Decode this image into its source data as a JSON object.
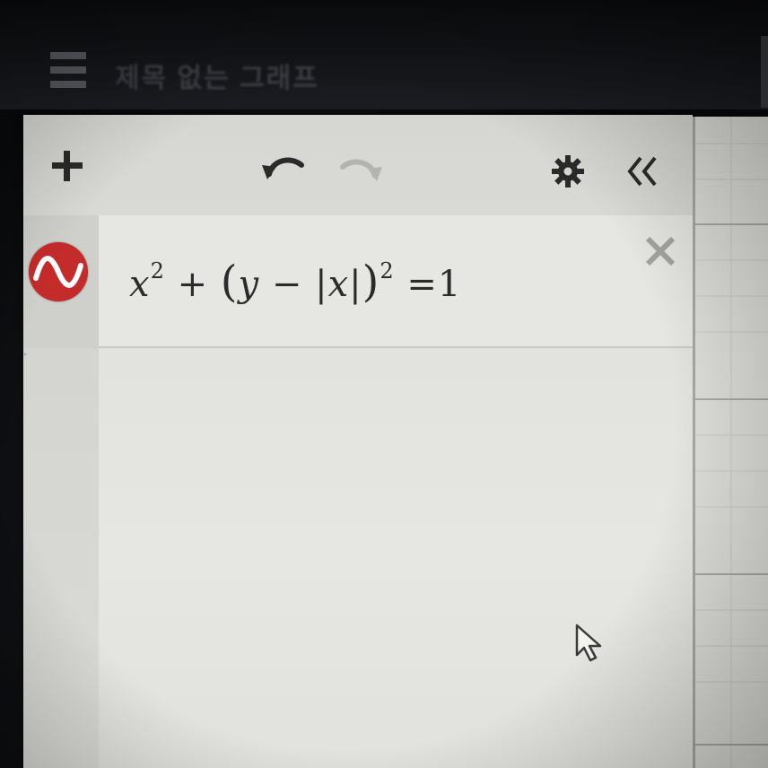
{
  "app": {
    "title": "제목 없는 그래프"
  },
  "toolbar": {
    "add_icon": "plus-icon",
    "undo_icon": "undo-icon",
    "redo_icon": "redo-icon",
    "settings_icon": "gear-icon",
    "collapse_icon": "double-chevron-left-icon"
  },
  "expressions": [
    {
      "color": "#c42b2b",
      "lhs_var1": "x",
      "lhs_exp1": "2",
      "op_plus": "+",
      "open_paren": "(",
      "var_y": "y",
      "op_minus": "−",
      "abs_open": "|",
      "abs_var": "x",
      "abs_close": "|",
      "close_paren": ")",
      "exp2": "2",
      "equals": "=",
      "rhs": "1"
    }
  ],
  "colors": {
    "expression_red": "#c42b2b",
    "panel_bg": "#e4e4e0",
    "title_bar": "#111215"
  }
}
